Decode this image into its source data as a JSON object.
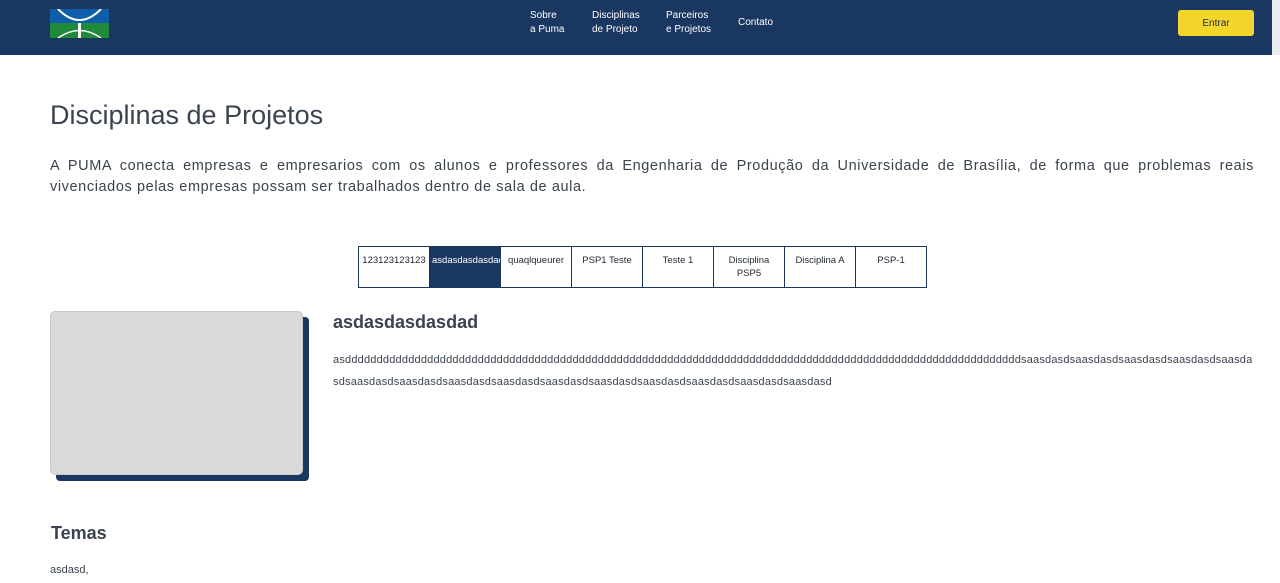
{
  "header": {
    "logo": "unb-logo",
    "nav": [
      {
        "line1": "Sobre",
        "line2": "a Puma"
      },
      {
        "line1": "Disciplinas",
        "line2": "de Projeto"
      },
      {
        "line1": "Parceiros",
        "line2": "e Projetos"
      },
      {
        "line1": "Contato",
        "line2": ""
      }
    ],
    "login_label": "Entrar",
    "colors": {
      "bar": "#1a3761",
      "button": "#f3d52c"
    }
  },
  "page": {
    "title": "Disciplinas de Projetos",
    "intro": "A PUMA conecta empresas e empresarios com os alunos e professores da Engenharia de Produção da Universidade de Brasília, de forma que problemas reais vivenciados pelas empresas possam ser trabalhados dentro de sala de aula."
  },
  "tabs": [
    {
      "label": "123123123123",
      "active": false
    },
    {
      "label": "asdasdasdasdad",
      "active": true
    },
    {
      "label": "quaqlqueurer",
      "active": false
    },
    {
      "label": "PSP1 Teste",
      "active": false
    },
    {
      "label": "Teste 1",
      "active": false
    },
    {
      "label": "Disciplina PSP5",
      "active": false
    },
    {
      "label": "Disciplina A",
      "active": false
    },
    {
      "label": "PSP-1",
      "active": false
    }
  ],
  "selected": {
    "title": "asdasdasdasdad",
    "description": "asdddddddddddddddddddddddddddddddddddddddddddddddddddddddddddddddddddddddddddddddddddddddddddddddddddddddddddsaasdasdsaasdasdsaasdasdsaasdasdsaasdasdsaasdasdsaasdasdsaasdasdsaasdasdsaasdasdsaasdasdsaasdasdsaasdasdsaasdasdsaasdasd",
    "themes_heading": "Temas",
    "themes": "asdasd,"
  }
}
